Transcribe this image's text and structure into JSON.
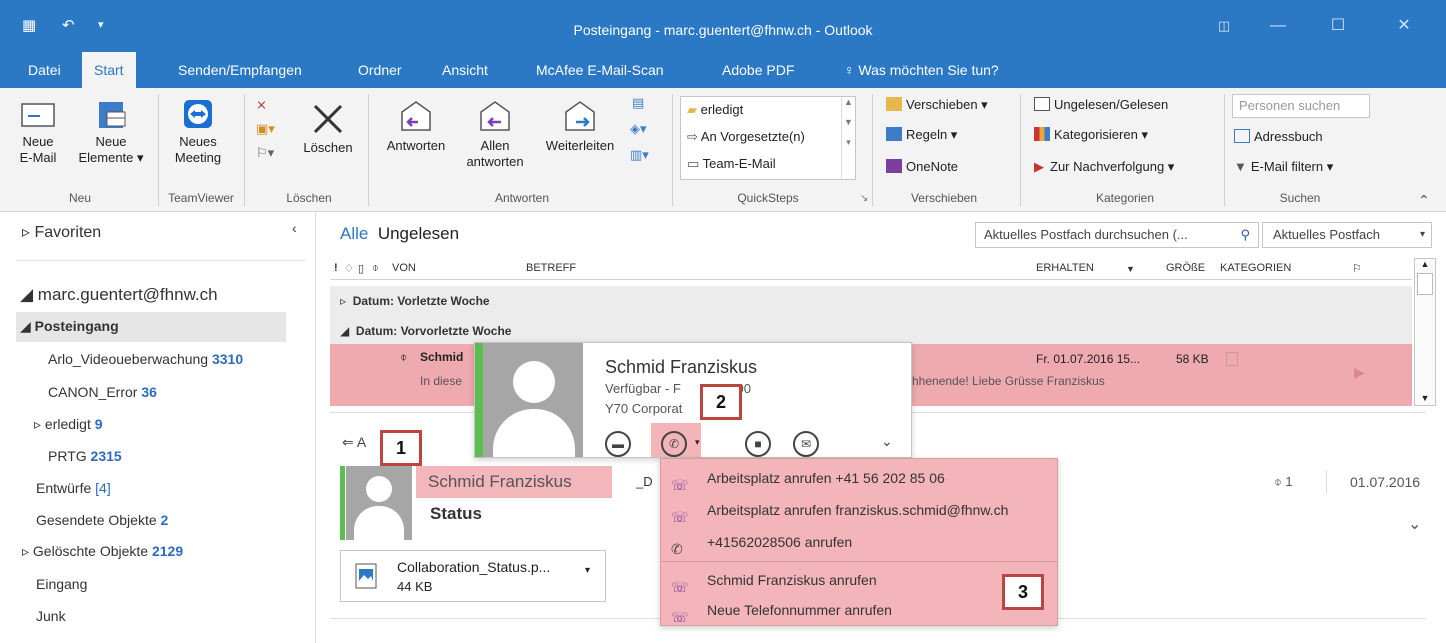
{
  "titlebar": {
    "title": "Posteingang - marc.guentert@fhnw.ch - Outlook"
  },
  "tabs": [
    "Datei",
    "Start",
    "Senden/Empfangen",
    "Ordner",
    "Ansicht",
    "McAfee E-Mail-Scan",
    "Adobe PDF",
    "Was möchten Sie tun?"
  ],
  "ribbon": {
    "neu": {
      "new_email": [
        "Neue",
        "E-Mail"
      ],
      "new_items": [
        "Neue",
        "Elemente ▾"
      ],
      "label": "Neu"
    },
    "teamviewer": {
      "meeting": [
        "Neues",
        "Meeting"
      ],
      "label": "TeamViewer"
    },
    "loeschen": {
      "delete": "Löschen",
      "label": "Löschen"
    },
    "antworten": {
      "reply": "Antworten",
      "reply_all": [
        "Allen",
        "antworten"
      ],
      "forward": "Weiterleiten",
      "label": "Antworten"
    },
    "quicksteps": {
      "items": [
        "erledigt",
        "An Vorgesetzte(n)",
        "Team-E-Mail"
      ],
      "label": "QuickSteps"
    },
    "verschieben": {
      "items": [
        "Verschieben ▾",
        "Regeln ▾",
        "OneNote"
      ],
      "label": "Verschieben"
    },
    "kategorien": {
      "items": [
        "Ungelesen/Gelesen",
        "Kategorisieren ▾",
        "Zur Nachverfolgung ▾"
      ],
      "label": "Kategorien"
    },
    "suchen": {
      "placeholder": "Personen suchen",
      "address_book": "Adressbuch",
      "filter": "E-Mail filtern ▾",
      "label": "Suchen"
    }
  },
  "nav": {
    "favorites": "Favoriten",
    "account": "marc.guentert@fhnw.ch",
    "inbox": "Posteingang",
    "folders": [
      {
        "name": "Arlo_Videoueberwachung",
        "count": "3310"
      },
      {
        "name": "CANON_Error",
        "count": "36"
      },
      {
        "name": "erledigt",
        "count": "9"
      },
      {
        "name": "PRTG",
        "count": "2315"
      },
      {
        "name": "Entwürfe",
        "count": "[4]"
      },
      {
        "name": "Gesendete Objekte",
        "count": "2"
      },
      {
        "name": "Gelöschte Objekte",
        "count": "2129"
      },
      {
        "name": "Eingang",
        "count": ""
      },
      {
        "name": "Junk",
        "count": ""
      }
    ]
  },
  "list": {
    "filter_all": "Alle",
    "filter_unread": "Ungelesen",
    "search_placeholder": "Aktuelles Postfach durchsuchen (...",
    "search_scope": "Aktuelles Postfach",
    "columns": {
      "from": "VON",
      "subject": "BETREFF",
      "received": "ERHALTEN",
      "size": "GRÖßE",
      "categories": "KATEGORIEN"
    },
    "groups": [
      "Datum: Vorletzte Woche",
      "Datum: Vorvorletzte Woche"
    ],
    "message": {
      "sender": "Schmid",
      "preview": "In diese",
      "preview_tail": "hhenende! Liebe Grüsse  Franziskus",
      "received": "Fr. 01.07.2016 15...",
      "size": "58 KB"
    }
  },
  "reading": {
    "reply": "A",
    "sender": "Schmid Franziskus",
    "subject_fragment": "_D",
    "subject": "Status",
    "attach_count": "1",
    "date": "01.07.2016",
    "attachment": {
      "name": "Collaboration_Status.p...",
      "size": "44 KB"
    }
  },
  "card": {
    "name": "Schmid Franziskus",
    "status": "Verfügbar - F",
    "status_tail": ":00",
    "company": "Y70 Corporat"
  },
  "call_menu": {
    "items": [
      "Arbeitsplatz anrufen +41 56 202 85 06",
      "Arbeitsplatz anrufen franziskus.schmid@fhnw.ch",
      "+41562028506 anrufen",
      "Schmid Franziskus anrufen",
      "Neue Telefonnummer anrufen"
    ]
  },
  "badges": [
    "1",
    "2",
    "3"
  ],
  "colors": {
    "accent": "#2b78c5",
    "highlight": "#eeaaaf",
    "badge_border": "#b9473f",
    "presence": "#5cbd52"
  }
}
